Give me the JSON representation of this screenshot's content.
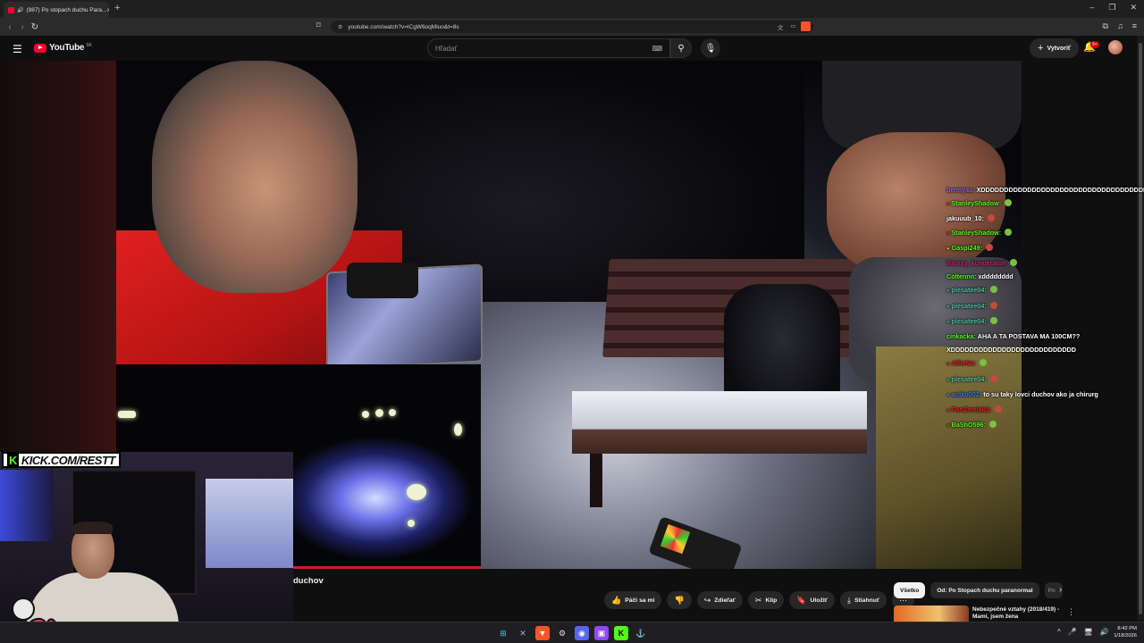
{
  "browser": {
    "tab_title": "(987) Po stopach duchu Para...",
    "url": "youtube.com/watch?v=lCgW6oqMluo&t=8s"
  },
  "youtube": {
    "logo_text": "YouTube",
    "region": "SK",
    "search_placeholder": "Hľadať",
    "create_label": "Vytvoriť",
    "notif_badge": "9+"
  },
  "stream_overlay": {
    "kick_text": "KICK.COM/RESTT"
  },
  "chat": [
    {
      "user": "bennyas:",
      "msg": "XDDDDDDDDDDDDDDDDDDDDDDDDDDDDDDDDDDDDDDDDDD",
      "color": "#8a6cf0"
    },
    {
      "user": "StanleyShadow:",
      "msg": "",
      "color": "#53fc18",
      "icon": "red-heart"
    },
    {
      "user": "jakuuub_10:",
      "msg": "",
      "color": "#ffffff"
    },
    {
      "user": "StanleyShadow:",
      "msg": "",
      "color": "#53fc18",
      "icon": "red-heart"
    },
    {
      "user": "Gaspi249:",
      "msg": "",
      "color": "#53fc18",
      "icon": "trophy"
    },
    {
      "user": "Bloxxy_kungkraton",
      "msg": "",
      "color": "#d0206a",
      "icon": ""
    },
    {
      "user": "Coltennn:",
      "msg": "xdddddddd",
      "color": "#53fc18"
    },
    {
      "user": "plesatee04:",
      "msg": "",
      "color": "#4fc3a0",
      "icon": "mod"
    },
    {
      "user": "plesatee04:",
      "msg": "",
      "color": "#4fc3a0",
      "icon": "mod"
    },
    {
      "user": "plesatee04:",
      "msg": "",
      "color": "#4fc3a0",
      "icon": "mod"
    },
    {
      "user": "cinkacka:",
      "msg": "AHA A TA POSTAVA MA 100CM?? XDDDDDDDDDDDDDDDDDDDDDDDDDDD",
      "color": "#53fc18"
    },
    {
      "user": "AlfIeNo:",
      "msg": "",
      "color": "#e02020",
      "icon": "red-heart"
    },
    {
      "user": "plesatee04:",
      "msg": "",
      "color": "#4fc3a0",
      "icon": "mod"
    },
    {
      "user": "autko002:",
      "msg": "to su taky lovci duchov ako ja chirurg",
      "color": "#3a7ae8",
      "icon": "blue-badge"
    },
    {
      "user": "PanZemiak1:",
      "msg": "",
      "color": "#e02020",
      "icon": "red-heart"
    },
    {
      "user": "BaShO596:",
      "msg": "",
      "color": "#53fc18",
      "icon": "brown-badge"
    }
  ],
  "video": {
    "title_fragment": "duchov"
  },
  "actions": [
    {
      "icon": "like-icon",
      "glyph": "👍",
      "label": "Páči sa mi"
    },
    {
      "icon": "dislike-icon",
      "glyph": "👎",
      "label": ""
    },
    {
      "icon": "share-icon",
      "glyph": "↪",
      "label": "Zdieľať"
    },
    {
      "icon": "clip-icon",
      "glyph": "✂",
      "label": "Klip"
    },
    {
      "icon": "save-icon",
      "glyph": "🔖",
      "label": "Uložiť"
    },
    {
      "icon": "download-icon",
      "glyph": "⤓",
      "label": "Stiahnuť"
    },
    {
      "icon": "more-icon",
      "glyph": "⋯",
      "label": ""
    }
  ],
  "chips": {
    "all": "Všetko",
    "from": "Od: Po Stopach duchu paranormal",
    "partial": "Po"
  },
  "recommendation": {
    "title": "Nebezpečné vztahy (2018/419) - Mami, jsem žena"
  },
  "taskbar": {
    "time": "8:42 PM",
    "date": "1/18/2026"
  }
}
